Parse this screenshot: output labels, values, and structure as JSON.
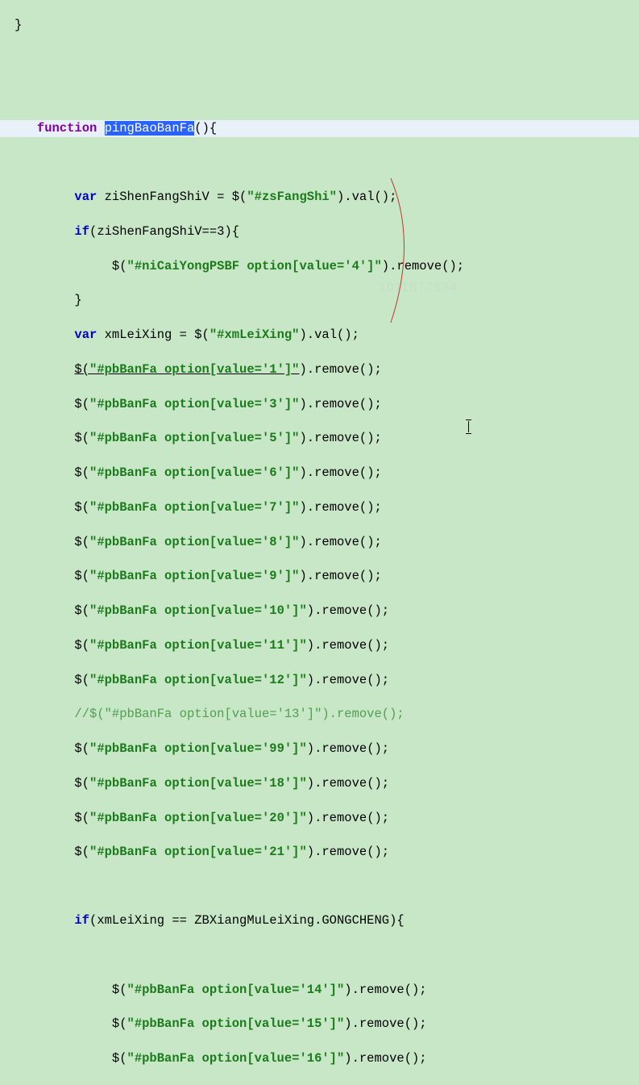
{
  "l1": "}",
  "l4_func": "function",
  "l4_name": "pingBaoBanFa",
  "l4_rest": "(){",
  "l6_pre": "var",
  "l6_mid": " ziShenFangShiV = $(",
  "l6_str": "\"#zsFangShi\"",
  "l6_post": ").val();",
  "l7_pre": "if",
  "l7_rest": "(ziShenFangShiV==3){",
  "l8_pre": "             $(",
  "l8_str": "\"#niCaiYongPSBF option[value='4']\"",
  "l8_post": ").remove();",
  "l9": "}",
  "l10_pre": "var",
  "l10_mid": " xmLeiXing = $(",
  "l10_str": "\"#xmLeiXing\"",
  "l10_post": ").val();",
  "pb1_pre": "$(",
  "pb1_str": "\"#pbBanFa option[value='1']\"",
  "pb1_post": ").remove();",
  "pb3_str": "\"#pbBanFa option[value='3']\"",
  "pb5_str": "\"#pbBanFa option[value='5']\"",
  "pb6_str": "\"#pbBanFa option[value='6']\"",
  "pb7_str": "\"#pbBanFa option[value='7']\"",
  "pb8_str": "\"#pbBanFa option[value='8']\"",
  "pb9_str": "\"#pbBanFa option[value='9']\"",
  "pb10_str": "\"#pbBanFa option[value='10']\"",
  "pb11_str": "\"#pbBanFa option[value='11']\"",
  "pb12_str": "\"#pbBanFa option[value='12']\"",
  "comment_13": "//$(\"#pbBanFa option[value='13']\").remove();",
  "pb99_str": "\"#pbBanFa option[value='99']\"",
  "pb18_str": "\"#pbBanFa option[value='18']\"",
  "pb20_str": "\"#pbBanFa option[value='20']\"",
  "pb21_str": "\"#pbBanFa option[value='21']\"",
  "if2_pre": "if",
  "if2_rest": "(xmLeiXing == ZBXiangMuLeiXing.GONGCHENG){",
  "pb14_str": "\"#pbBanFa option[value='14']\"",
  "pb15_str": "\"#pbBanFa option[value='15']\"",
  "pb16_str": "\"#pbBanFa option[value='16']\"",
  "dollar_open": "$(",
  "remove_close": ").remove();",
  "watermark": "1011877584",
  "indent": "        ",
  "indent2": "             "
}
